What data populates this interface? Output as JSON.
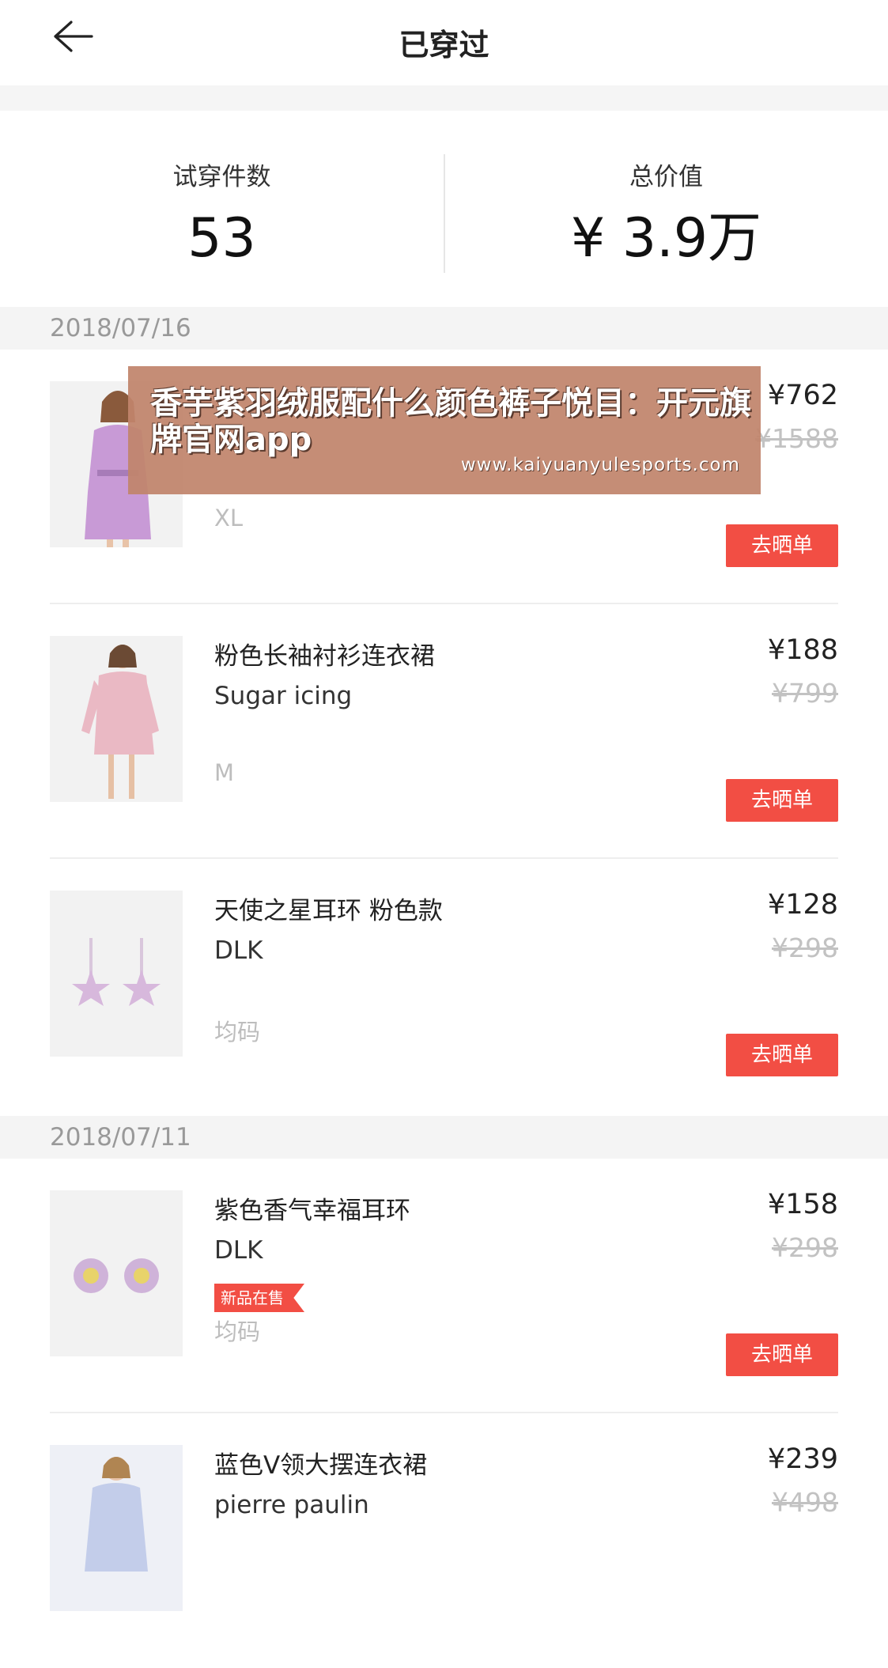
{
  "header": {
    "title": "已穿过",
    "back_icon": "arrow-left-icon"
  },
  "stats": {
    "tryon_label": "试穿件数",
    "tryon_value": "53",
    "total_label": "总价值",
    "total_value": "¥ 3.9万"
  },
  "overlay": {
    "title": "香芋紫羽绒服配什么颜色裤子悦目：开元旗牌官网app",
    "url": "www.kaiyuanyulesports.com"
  },
  "groups": [
    {
      "date": "2018/07/16",
      "items": [
        {
          "name": "",
          "brand": "",
          "size": "XL",
          "price": "¥762",
          "original_price": "¥1588",
          "action": "去晒单"
        },
        {
          "name": "粉色长袖衬衫连衣裙",
          "brand": "Sugar icing",
          "size": "M",
          "price": "¥188",
          "original_price": "¥799",
          "action": "去晒单"
        },
        {
          "name": "天使之星耳环 粉色款",
          "brand": "DLK",
          "size": "均码",
          "price": "¥128",
          "original_price": "¥298",
          "action": "去晒单"
        }
      ]
    },
    {
      "date": "2018/07/11",
      "items": [
        {
          "name": "紫色香气幸福耳环",
          "brand": "DLK",
          "badge": "新品在售",
          "size": "均码",
          "price": "¥158",
          "original_price": "¥298",
          "action": "去晒单"
        },
        {
          "name": "蓝色V领大摆连衣裙",
          "brand": "pierre paulin",
          "price": "¥239",
          "original_price": "¥498"
        }
      ]
    }
  ],
  "colors": {
    "accent": "#f24e44",
    "muted": "#bdbdbd",
    "band": "#f4f4f4",
    "overlay": "#c1846c"
  }
}
